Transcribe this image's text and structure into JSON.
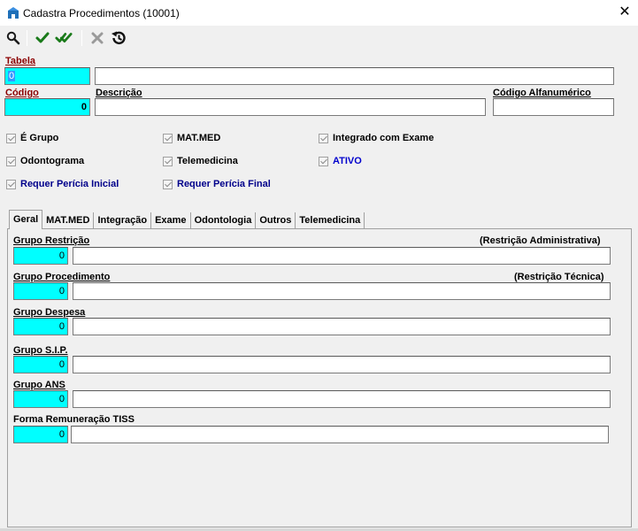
{
  "window": {
    "title": "Cadastra Procedimentos (10001)",
    "close_glyph": "✕"
  },
  "toolbar": {
    "buttons": [
      {
        "icon": "search-icon"
      },
      {
        "icon": "check-icon"
      },
      {
        "icon": "double-check-icon"
      },
      {
        "icon": "cancel-x-icon"
      },
      {
        "icon": "history-icon"
      }
    ]
  },
  "header": {
    "tabela_label": "Tabela",
    "tabela_value": "0",
    "tabela_desc": "",
    "codigo_label": "Código",
    "codigo_value": "0",
    "descricao_label": "Descrição",
    "descricao_value": "",
    "codigo_alfa_label": "Código Alfanumérico",
    "codigo_alfa_value": ""
  },
  "checkboxes": {
    "e_grupo": "É Grupo",
    "mat_med": "MAT.MED",
    "integrado_exame": "Integrado com Exame",
    "odontograma": "Odontograma",
    "telemedicina": "Telemedicina",
    "ativo": "ATIVO",
    "pericia_inicial": "Requer Perícia Inicial",
    "pericia_final": "Requer Perícia Final"
  },
  "tabs": [
    "Geral",
    "MAT.MED",
    "Integração",
    "Exame",
    "Odontologia",
    "Outros",
    "Telemedicina"
  ],
  "geral": {
    "grupo_restricao_label": "Grupo Restrição",
    "restricao_admin_label": "(Restrição Administrativa)",
    "grupo_restricao_value": "0",
    "grupo_procedimento_label": "Grupo Procedimento",
    "restricao_tecnica_label": "(Restrição Técnica)",
    "grupo_procedimento_value": "0",
    "grupo_despesa_label": "Grupo Despesa",
    "grupo_despesa_value": "0",
    "grupo_sip_label": "Grupo S.I.P.",
    "grupo_sip_value": "0",
    "grupo_ans_label": "Grupo ANS",
    "grupo_ans_value": "0",
    "forma_remuneracao_label": "Forma Remuneração TISS",
    "forma_remuneracao_value": "0"
  }
}
